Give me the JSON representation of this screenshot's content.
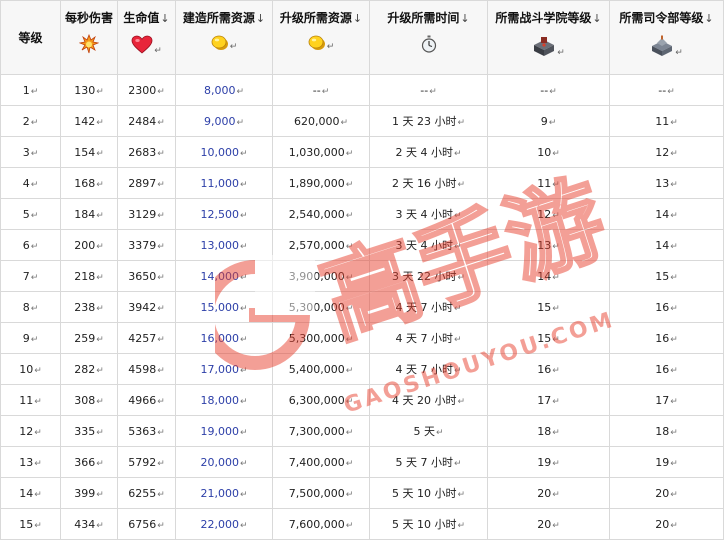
{
  "headers": {
    "level": "等级",
    "dps": "每秒伤害",
    "hp": "生命值",
    "build_cost": "建造所需资源",
    "upgrade_cost": "升级所需资源",
    "upgrade_time": "升级所需时间",
    "req_academy": "所需战斗学院等级",
    "req_hq": "所需司令部等级"
  },
  "icons": {
    "dps": "fire-explosion-icon",
    "hp": "heart-icon",
    "build_cost": "gold-coin-icon",
    "upgrade_cost": "gold-coin-icon",
    "upgrade_time": "stopwatch-icon",
    "req_academy": "academy-building-icon",
    "req_hq": "headquarters-building-icon"
  },
  "colors": {
    "build_cost_text": "#2d3fa8",
    "watermark": "#e8412f"
  },
  "watermark": {
    "brand": "高手游",
    "domain": "GAOSHOUYOU.COM"
  },
  "rows": [
    {
      "level": "1",
      "dps": "130",
      "hp": "2300",
      "build": "8,000",
      "upgrade": "--",
      "time": "--",
      "academy": "--",
      "hq": "--"
    },
    {
      "level": "2",
      "dps": "142",
      "hp": "2484",
      "build": "9,000",
      "upgrade": "620,000",
      "time": "1 天 23 小时",
      "academy": "9",
      "hq": "11"
    },
    {
      "level": "3",
      "dps": "154",
      "hp": "2683",
      "build": "10,000",
      "upgrade": "1,030,000",
      "time": "2 天 4 小时",
      "academy": "10",
      "hq": "12"
    },
    {
      "level": "4",
      "dps": "168",
      "hp": "2897",
      "build": "11,000",
      "upgrade": "1,890,000",
      "time": "2 天 16 小时",
      "academy": "11",
      "hq": "13"
    },
    {
      "level": "5",
      "dps": "184",
      "hp": "3129",
      "build": "12,500",
      "upgrade": "2,540,000",
      "time": "3 天 4 小时",
      "academy": "12",
      "hq": "14"
    },
    {
      "level": "6",
      "dps": "200",
      "hp": "3379",
      "build": "13,000",
      "upgrade": "2,570,000",
      "time": "3 天 4 小时",
      "academy": "13",
      "hq": "14"
    },
    {
      "level": "7",
      "dps": "218",
      "hp": "3650",
      "build": "14,000",
      "upgrade": "3,900,000",
      "time": "3 天 22 小时",
      "academy": "14",
      "hq": "15"
    },
    {
      "level": "8",
      "dps": "238",
      "hp": "3942",
      "build": "15,000",
      "upgrade": "5,300,000",
      "time": "4 天 7 小时",
      "academy": "15",
      "hq": "16"
    },
    {
      "level": "9",
      "dps": "259",
      "hp": "4257",
      "build": "16,000",
      "upgrade": "5,300,000",
      "time": "4 天 7 小时",
      "academy": "15",
      "hq": "16"
    },
    {
      "level": "10",
      "dps": "282",
      "hp": "4598",
      "build": "17,000",
      "upgrade": "5,400,000",
      "time": "4 天 7 小时",
      "academy": "16",
      "hq": "16"
    },
    {
      "level": "11",
      "dps": "308",
      "hp": "4966",
      "build": "18,000",
      "upgrade": "6,300,000",
      "time": "4 天 20 小时",
      "academy": "17",
      "hq": "17"
    },
    {
      "level": "12",
      "dps": "335",
      "hp": "5363",
      "build": "19,000",
      "upgrade": "7,300,000",
      "time": "5 天",
      "academy": "18",
      "hq": "18"
    },
    {
      "level": "13",
      "dps": "366",
      "hp": "5792",
      "build": "20,000",
      "upgrade": "7,400,000",
      "time": "5 天 7 小时",
      "academy": "19",
      "hq": "19"
    },
    {
      "level": "14",
      "dps": "399",
      "hp": "6255",
      "build": "21,000",
      "upgrade": "7,500,000",
      "time": "5 天 10 小时",
      "academy": "20",
      "hq": "20"
    },
    {
      "level": "15",
      "dps": "434",
      "hp": "6756",
      "build": "22,000",
      "upgrade": "7,600,000",
      "time": "5 天 10 小时",
      "academy": "20",
      "hq": "20"
    }
  ]
}
